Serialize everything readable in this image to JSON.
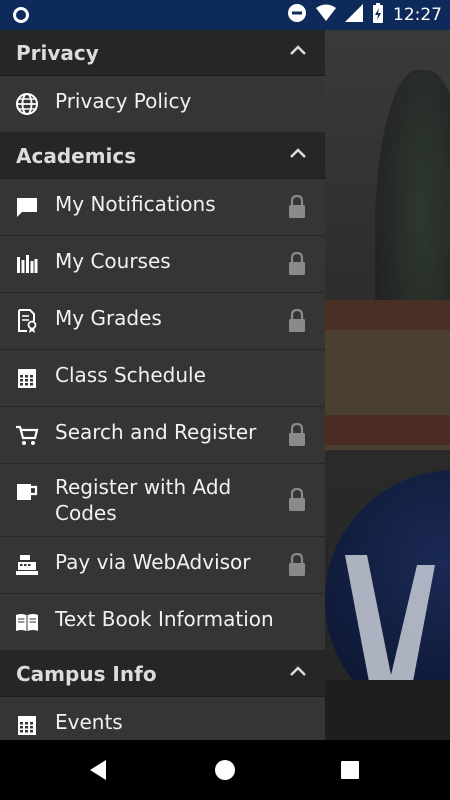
{
  "status_bar": {
    "time": "12:27"
  },
  "drawer": {
    "privacy": {
      "title": "Privacy",
      "items": [
        {
          "label": "Privacy Policy",
          "icon": "globe-icon"
        }
      ]
    },
    "academics": {
      "title": "Academics",
      "items": [
        {
          "label": "My Notifications",
          "icon": "chat-bubble-icon",
          "locked": true
        },
        {
          "label": "My Courses",
          "icon": "books-icon",
          "locked": true
        },
        {
          "label": "My Grades",
          "icon": "certificate-icon",
          "locked": true
        },
        {
          "label": "Class Schedule",
          "icon": "calendar-icon",
          "locked": false
        },
        {
          "label": "Search and Register",
          "icon": "cart-icon",
          "locked": true
        },
        {
          "label": "Register with Add Codes",
          "icon": "ticket-icon",
          "locked": true
        },
        {
          "label": "Pay via WebAdvisor",
          "icon": "cash-register-icon",
          "locked": true
        },
        {
          "label": "Text Book Information",
          "icon": "open-book-icon",
          "locked": false
        }
      ]
    },
    "campus_info": {
      "title": "Campus Info",
      "items": [
        {
          "label": "Events",
          "icon": "calendar-icon"
        }
      ]
    }
  },
  "colors": {
    "status_bar": "#0d2a5a",
    "drawer_bg": "#333333",
    "header_bg": "#262626",
    "text": "#f1f1f1",
    "icon": "#ffffff",
    "lock": "#8a8a8a"
  }
}
